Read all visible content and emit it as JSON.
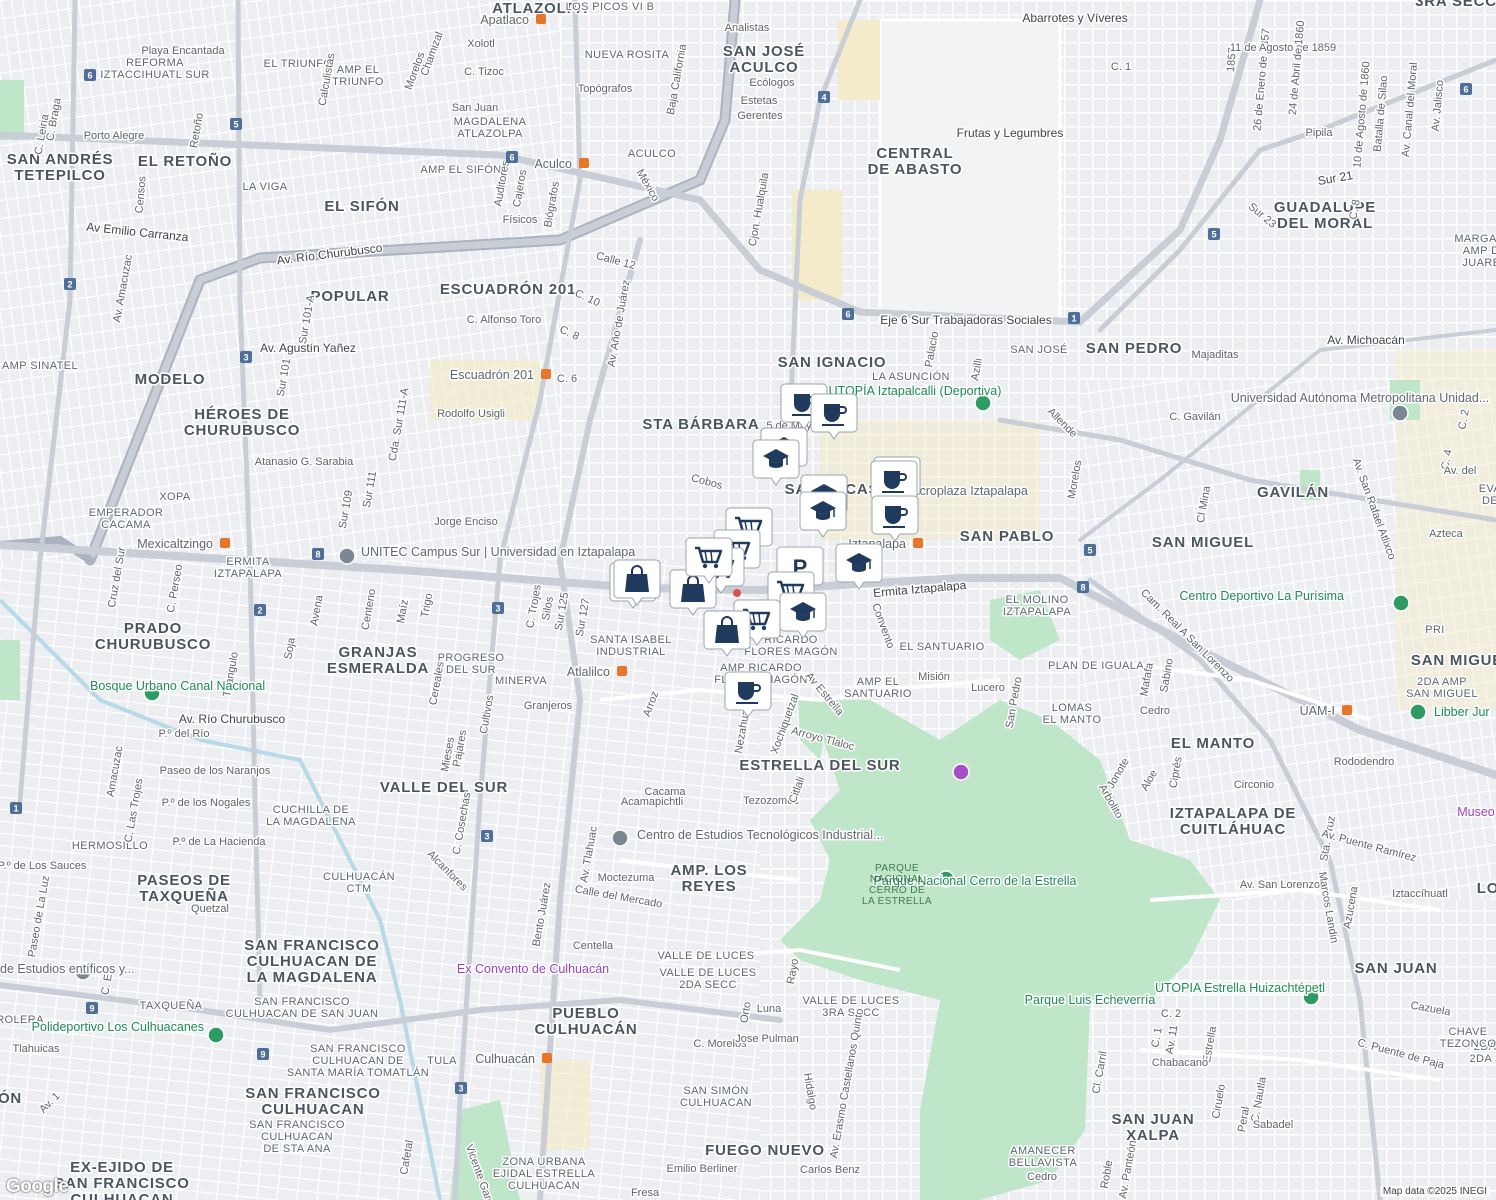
{
  "attribution": "Map data ©2025 INEGI",
  "logo": "Google",
  "colors": {
    "background": "#eceef2",
    "street": "#ffffff",
    "arterial": "#c9ced6",
    "highway": "#aab3bf",
    "park": "#bfe6c9",
    "industrial": "#f1ecd6",
    "marker": "#1f3a5c",
    "metro": "#e5762a"
  },
  "neighborhoods": [
    {
      "id": "atlazolpa",
      "lines": [
        "ATLAZOLPA"
      ]
    },
    {
      "id": "san-jose-aculco",
      "lines": [
        "SAN JOSÉ",
        "ACULCO"
      ]
    },
    {
      "id": "central-de-abasto",
      "lines": [
        "CENTRAL",
        "DE ABASTO"
      ]
    },
    {
      "id": "san-andres-tetepilco",
      "lines": [
        "SAN ANDRÉS",
        "TETEPILCO"
      ]
    },
    {
      "id": "el-retono",
      "lines": [
        "EL RETOÑO"
      ]
    },
    {
      "id": "el-sifon",
      "lines": [
        "EL SIFÓN"
      ]
    },
    {
      "id": "guadalupe-del-moral",
      "lines": [
        "GUADALUPE",
        "DEL MORAL"
      ]
    },
    {
      "id": "popular",
      "lines": [
        "POPULAR"
      ]
    },
    {
      "id": "escuadron-201",
      "lines": [
        "ESCUADRÓN 201"
      ]
    },
    {
      "id": "modelo",
      "lines": [
        "MODELO"
      ]
    },
    {
      "id": "san-ignacio",
      "lines": [
        "SAN IGNACIO"
      ]
    },
    {
      "id": "san-pedro",
      "lines": [
        "SAN PEDRO"
      ]
    },
    {
      "id": "heroes-de-churubusco",
      "lines": [
        "HÉROES DE",
        "CHURUBUSCO"
      ]
    },
    {
      "id": "sta-barbara",
      "lines": [
        "STA BÁRBARA"
      ]
    },
    {
      "id": "san-lucas",
      "lines": [
        "SAN LUCAS"
      ]
    },
    {
      "id": "gavilan",
      "lines": [
        "GAVILÁN"
      ]
    },
    {
      "id": "san-pablo",
      "lines": [
        "SAN PABLO"
      ]
    },
    {
      "id": "san-miguel",
      "lines": [
        "SAN MIGUEL"
      ]
    },
    {
      "id": "prado-churubusco",
      "lines": [
        "PRADO",
        "CHURUBUSCO"
      ]
    },
    {
      "id": "granjas-esmeralda",
      "lines": [
        "GRANJAS",
        "ESMERALDA"
      ]
    },
    {
      "id": "san-miguel-2",
      "lines": [
        "SAN MIGUE"
      ]
    },
    {
      "id": "estrella-del-sur",
      "lines": [
        "ESTRELLA DEL SUR"
      ]
    },
    {
      "id": "el-manto",
      "lines": [
        "EL MANTO"
      ]
    },
    {
      "id": "valle-del-sur",
      "lines": [
        "VALLE DEL SUR"
      ]
    },
    {
      "id": "iztapalapa-de-cuitlahuac",
      "lines": [
        "IZTAPALAPA DE",
        "CUITLÁHUAC"
      ]
    },
    {
      "id": "paseos-de-taxquena",
      "lines": [
        "PASEOS DE",
        "TAXQUEÑA"
      ]
    },
    {
      "id": "amp-los-reyes",
      "lines": [
        "AMP. LOS",
        "REYES"
      ]
    },
    {
      "id": "san-francisco-culhuacan-de-la-magdalena",
      "lines": [
        "SAN FRANCISCO",
        "CULHUACAN DE",
        "LA MAGDALENA"
      ]
    },
    {
      "id": "san-juan",
      "lines": [
        "SAN JUAN"
      ]
    },
    {
      "id": "pueblo-culhuacan",
      "lines": [
        "PUEBLO",
        "CULHUACÁN"
      ]
    },
    {
      "id": "san-francisco-culhuacan",
      "lines": [
        "SAN FRANCISCO",
        "CULHUACAN"
      ]
    },
    {
      "id": "san-juan-xalpa",
      "lines": [
        "SAN JUAN",
        "XALPA"
      ]
    },
    {
      "id": "fuego-nuevo",
      "lines": [
        "FUEGO NUEVO"
      ]
    },
    {
      "id": "ex-ejido-de-san-francisco-culhuacan",
      "lines": [
        "EX-EJIDO DE",
        "SAN FRANCISCO",
        "CULHUACAN"
      ]
    },
    {
      "id": "lo",
      "lines": [
        "LO"
      ]
    },
    {
      "id": "on",
      "lines": [
        "ÓN"
      ]
    },
    {
      "id": "sra-secc",
      "lines": [
        "3RA SECC"
      ]
    }
  ],
  "small_areas": [
    {
      "lines": [
        "LOS PICOS VI B"
      ]
    },
    {
      "lines": [
        "REFORMA",
        "IZTACCIHUATL SUR"
      ]
    },
    {
      "lines": [
        "EL TRIUNFO"
      ]
    },
    {
      "lines": [
        "AMP EL",
        "TRIUNFO"
      ]
    },
    {
      "lines": [
        "NUEVA ROSITA"
      ]
    },
    {
      "lines": [
        "MAGDALENA",
        "ATLAZOLPA"
      ]
    },
    {
      "lines": [
        "ACULCO"
      ]
    },
    {
      "lines": [
        "AMP EL SIFÓN"
      ]
    },
    {
      "lines": [
        "LA VIGA"
      ]
    },
    {
      "lines": [
        "AMP SINATEL"
      ]
    },
    {
      "lines": [
        "XOPA"
      ]
    },
    {
      "lines": [
        "EMPERADOR",
        "CACAMA"
      ]
    },
    {
      "lines": [
        "ERMITA",
        "IZTAPALAPA"
      ]
    },
    {
      "lines": [
        "SANTA ISABEL",
        "INDUSTRIAL"
      ]
    },
    {
      "lines": [
        "PROGRESO",
        "DEL SUR"
      ]
    },
    {
      "lines": [
        "MINERVA"
      ]
    },
    {
      "lines": [
        "RICARDO",
        "FLORES MAGÓN"
      ]
    },
    {
      "lines": [
        "AMP RICARDO",
        "FLORES MAGÓN"
      ]
    },
    {
      "lines": [
        "AMP EL",
        "SANTUARIO"
      ]
    },
    {
      "lines": [
        "EL SANTUARIO"
      ]
    },
    {
      "lines": [
        "EL MOLINO",
        "IZTAPALAPA"
      ]
    },
    {
      "lines": [
        "PLAN DE IGUALA"
      ]
    },
    {
      "lines": [
        "LOMAS",
        "EL MANTO"
      ]
    },
    {
      "lines": [
        "LA ASUNCIÓN"
      ]
    },
    {
      "lines": [
        "SAN JOSÉ"
      ]
    },
    {
      "lines": [
        "CUCHILLA DE",
        "LA MAGDALENA"
      ]
    },
    {
      "lines": [
        "HERMOSILLO"
      ]
    },
    {
      "lines": [
        "CULHUACÁN",
        "CTM"
      ]
    },
    {
      "lines": [
        "VALLE DE LUCES"
      ]
    },
    {
      "lines": [
        "VALLE DE LUCES",
        "2DA SECC"
      ]
    },
    {
      "lines": [
        "VALLE DE LUCES",
        "3RA SECC"
      ]
    },
    {
      "lines": [
        "TAXQUEÑA"
      ]
    },
    {
      "lines": [
        "SAN FRANCISCO",
        "CULHUACAN DE SAN JUAN"
      ]
    },
    {
      "lines": [
        "SAN FRANCISCO",
        "CULHUACAN DE",
        "SANTA MARÍA TOMATLÁN"
      ]
    },
    {
      "lines": [
        "TULA"
      ]
    },
    {
      "lines": [
        "SAN SIMÓN",
        "CULHUACAN"
      ]
    },
    {
      "lines": [
        "SAN FRANCISCO",
        "CULHUACAN",
        "DE STA ANA"
      ]
    },
    {
      "lines": [
        "ZONA URBANA",
        "EJIDAL ESTRELLA",
        "CULHUACAN"
      ]
    },
    {
      "lines": [
        "AMANECER",
        "BELLAVISTA"
      ]
    },
    {
      "lines": [
        "2DA AMP",
        "SAN MIGUEL"
      ]
    },
    {
      "lines": [
        "MARGARIT",
        "AMP DE",
        "JUAREZ"
      ]
    },
    {
      "lines": [
        "PRI"
      ]
    },
    {
      "lines": [
        "EVA",
        "DE"
      ]
    },
    {
      "lines": [
        "2DA A",
        "2DA SE"
      ]
    },
    {
      "lines": [
        "ROLERA"
      ]
    },
    {
      "lines": [
        "CHAVE",
        "TEZONCO"
      ]
    }
  ],
  "streets": [
    "Abarrotes y Víveres",
    "Analistas",
    "Playa Encantada",
    "Xolotl",
    "Chamizal",
    "Morelos",
    "C. Tizoc",
    "Topógrafos",
    "Baja California",
    "Ecólogos",
    "Estetas",
    "Gerentes",
    "Calculistas",
    "San Juan",
    "C. 1",
    "Frutas y Legumbres",
    "Porto Alegre",
    "C. Braga",
    "C. Leiria",
    "Retoño",
    "Censos",
    "Auditores",
    "Cajeros",
    "Físicos",
    "Biógrafos",
    "México",
    "Cjon. Hualquila",
    "Av. Río Churubusco",
    "Av Emilio Carranza",
    "Av. Amacuzac",
    "Calle 12",
    "C. 10",
    "C. Alfonso Toro",
    "C. 8",
    "C. 6",
    "Eje 6 Sur Trabajadoras Sociales",
    "Palacio",
    "Azilli",
    "Majaditas",
    "Av. Michoacán",
    "Av. Agustín Yañez",
    "Sur 101",
    "Sur 101-A",
    "Av. Año de Juárez",
    "Rodolfo Usigli",
    "Atanasio G. Sarabia",
    "Cda. Sur 111-A",
    "Sur 111",
    "Sur 109",
    "5 de Mayo",
    "Allende",
    "C. Gavilán",
    "Morelos",
    "Cobos",
    "Jorge Enciso",
    "Ermita Iztapalapa",
    "Cl Mina",
    "Av. San Rafael Atlixco",
    "Cruz del Sur",
    "C. Perseo",
    "Avena",
    "Centeno",
    "Maíz",
    "Trigo",
    "Soja",
    "C. Trojes",
    "Silos",
    "Sur 125",
    "Sur 127",
    "Convento",
    "Cam. Real A San Lorenzo",
    "Mafafa",
    "Sabino",
    "Cedro",
    "Triángulo",
    "Cereales",
    "Mieses",
    "Pajares",
    "Cultivos",
    "Granjeros",
    "Arroz",
    "Nezahualpilli",
    "Xochiquetzal",
    "Av Estrella",
    "Arroyo Tlaloc",
    "Misión",
    "Lucero",
    "San Pedro",
    "Jonote",
    "Aloe",
    "Ciprés",
    "Arbolito",
    "Circonio",
    "Rododendro",
    "Av. Río Churubusco",
    "P.º del Río",
    "Paseo de los Naranjos",
    "P.º de los Nogales",
    "P.º de La Hacienda",
    "Amacuzac",
    "C. Las Trojes",
    "Cacama",
    "Acamapichtli",
    "Tezozomoc",
    "Citlali",
    "C. Cosechas",
    "Alcanfores",
    "Bento Juárez",
    "Av. Tlahuac",
    "Moctezuma",
    "Calle del Mercado",
    "P.º de Los Sauces",
    "Quetzal",
    "Paseo de La Luz",
    "C. E",
    "Centella",
    "Rayo",
    "Orto",
    "Luna",
    "C. Morelos",
    "Jose Pulman",
    "Hidalgo",
    "Av. Erasmo Castellanos Quinto",
    "Av. 1",
    "Tlahuicas",
    "Cafetal",
    "Vicente García",
    "Emilio Berliner",
    "Carlos Benz",
    "Fresa",
    "Cl. Carril",
    "C. 2",
    "C. 1",
    "Av. 11",
    "Estrella",
    "Chabacano",
    "Ciruelo",
    "Peral",
    "C. Nautla",
    "Sabadel",
    "Cedro",
    "Roble",
    "Av. Panteón",
    "Av. San Lorenzo",
    "Marcos Landin",
    "Azucena",
    "Sta. Cruz",
    "Av. Puente Ramírez",
    "Iztaccíhuatl",
    "Cazuela",
    "C. Puente de Paja",
    "1857",
    "26 de Enero de 1857",
    "11 de Agosto de 1859",
    "24 de Abril de 1860",
    "10 de Agosto de 1860",
    "Batalla de Silao",
    "Av. Canal del Moral",
    "Av. Jalisco",
    "Pipila",
    "Sur 21",
    "Sur 23",
    "C. 8",
    "C. 4",
    "C. 2",
    "Av. del",
    "Azteca"
  ],
  "pois": {
    "metro": [
      "Apatlaco",
      "Aculco",
      "Escuadrón 201",
      "Mexicaltzingo",
      "Atlalilco",
      "Iztapalapa",
      "Culhuacán",
      "UAM-I"
    ],
    "schools": [
      "UNITEC Campus Sur | Universidad en Iztapalapa",
      "Universidad Autónoma Metropolitana Unidad...",
      "Centro de Estudios Tecnológicos Industrial...",
      "de Estudios entíficos y..."
    ],
    "parks": [
      "Bosque Urbano Canal Nacional",
      "Polideportivo Los Culhuacanes",
      "Parque Luis Echeverría",
      "UTOPIA Estrella Huizachtépetl",
      "Libber Jur",
      "Parque Nacional Cerro de la Estrella"
    ],
    "sports": [
      "UTOPÍA Iztapalcalli (Deportiva)",
      "Centro Deportivo La Purísima"
    ],
    "culture": [
      "Ex Convento de Culhuacán",
      "Macroplaza Iztapalapa",
      "Museo"
    ],
    "park_area_label": [
      "PARQUE",
      "NACIONAL",
      "CERRO DE",
      "LA ESTRELLA"
    ]
  },
  "route_shields": [
    "6",
    "4",
    "5",
    "6",
    "6",
    "1",
    "2",
    "3",
    "8",
    "2",
    "5",
    "8",
    "3",
    "3",
    "1",
    "9",
    "9",
    "3",
    "6",
    "5"
  ],
  "markers": [
    {
      "type": "coffee-icon"
    },
    {
      "type": "coffee-icon"
    },
    {
      "type": "school-icon"
    },
    {
      "type": "school-icon"
    },
    {
      "type": "coffee-icon"
    },
    {
      "type": "coffee-icon"
    },
    {
      "type": "coffee-icon"
    },
    {
      "type": "school-icon"
    },
    {
      "type": "school-icon"
    },
    {
      "type": "cart-icon"
    },
    {
      "type": "cart-icon"
    },
    {
      "type": "cart-icon"
    },
    {
      "type": "parking-icon"
    },
    {
      "type": "cart-icon"
    },
    {
      "type": "bag-icon"
    },
    {
      "type": "bag-icon"
    },
    {
      "type": "bag-icon"
    },
    {
      "type": "school-icon"
    },
    {
      "type": "school-icon"
    },
    {
      "type": "cart-icon"
    },
    {
      "type": "cart-icon"
    },
    {
      "type": "bag-icon"
    },
    {
      "type": "coffee-icon"
    }
  ]
}
